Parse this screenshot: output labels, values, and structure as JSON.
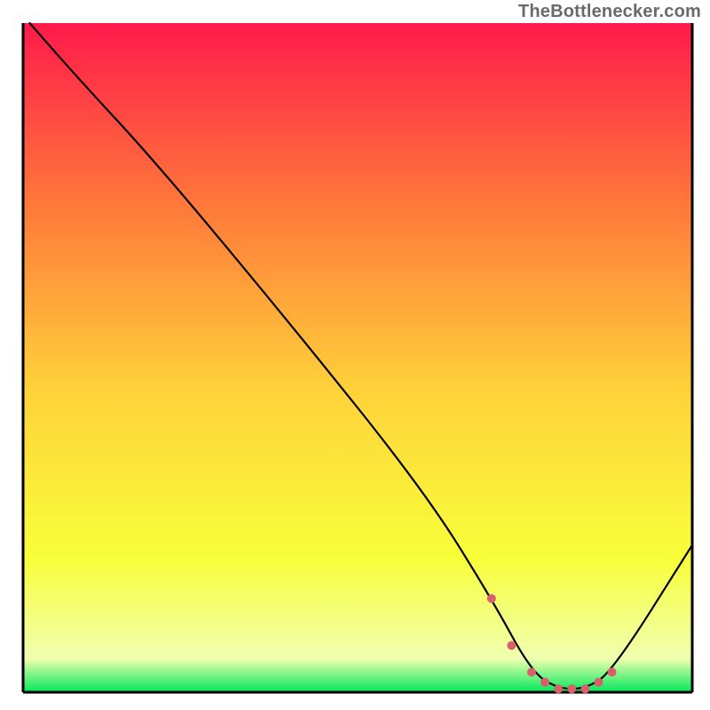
{
  "attribution": "TheBottlenecker.com",
  "chart_data": {
    "type": "line",
    "title": "",
    "xlabel": "",
    "ylabel": "",
    "xlim": [
      0,
      100
    ],
    "ylim": [
      0,
      100
    ],
    "series": [
      {
        "name": "bottleneck-curve",
        "x": [
          1,
          8,
          20,
          40,
          60,
          70,
          76,
          80,
          84,
          88,
          100
        ],
        "y": [
          100,
          92,
          79,
          55,
          30,
          14,
          3,
          0.5,
          0.5,
          3,
          22
        ]
      }
    ],
    "highlight": {
      "name": "optimal-range",
      "x_range": [
        70,
        88
      ],
      "dot_x": [
        70,
        73,
        76,
        78,
        80,
        82,
        84,
        86,
        88
      ],
      "dot_y": [
        14,
        7,
        3,
        1.5,
        0.5,
        0.5,
        0.5,
        1.5,
        3
      ]
    },
    "gradient_colors": {
      "top": "#ff1a4b",
      "upper_mid": "#ff7b3a",
      "mid": "#ffd23a",
      "lower_mid": "#f8ff3a",
      "near_bottom": "#f0ffb0",
      "bottom": "#00e85a"
    }
  }
}
